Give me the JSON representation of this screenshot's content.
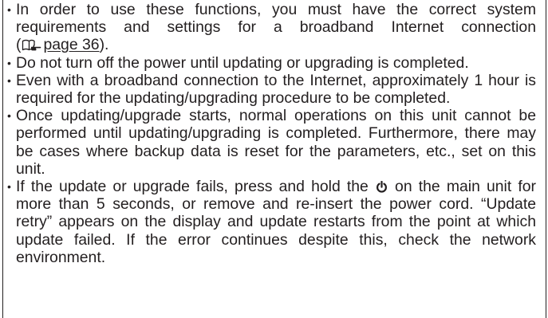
{
  "notes": {
    "bullet": "•",
    "item1": {
      "text": "In order to use these functions, you must have the correct system requirements and settings for a broadband Internet connection ",
      "ref_open": "(",
      "ref_icon": "book-pointing-hand-icon",
      "ref_link": "page 36",
      "ref_close": ")."
    },
    "item2": {
      "text": "Do not turn off the power until updating or upgrading is completed."
    },
    "item3": {
      "text": "Even with a broadband connection to the Internet, approximately 1 hour is required for the updating/upgrading procedure to be completed."
    },
    "item4": {
      "text": "Once updating/upgrade starts, normal operations on this unit cannot be performed until updating/upgrading is completed. Furthermore, there may be cases where backup data is reset for the parameters, etc., set on this unit."
    },
    "item5": {
      "text_before": "If the update or upgrade fails, press and hold the ",
      "icon": "power-icon",
      "text_after": " on the main unit for more than 5 seconds, or remove and re-insert the power cord. “Update retry” appears on the display and update restarts from the point at which update failed. If the error continues despite this, check the network environment."
    }
  }
}
